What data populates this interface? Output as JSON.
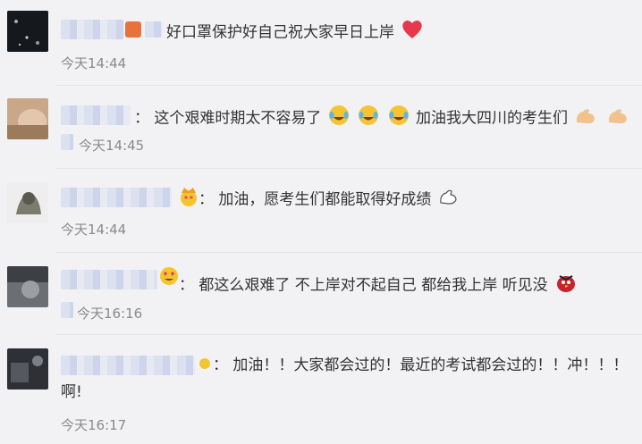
{
  "comments": [
    {
      "text": "好口罩保护好自己祝大家早日上岸",
      "emojis_after": [
        "heart-icon"
      ],
      "time": "今天14:44"
    },
    {
      "text": "这个艰难时期太不容易了",
      "mid_emojis": [
        "laugh-cry-icon",
        "laugh-cry-icon",
        "laugh-cry-icon"
      ],
      "text2": "加油我大四川的考生们",
      "emojis_after": [
        "muscle-icon",
        "muscle-icon"
      ],
      "time": "今天14:45"
    },
    {
      "text": "加油，愿考生们都能取得好成绩",
      "emojis_after": [
        "muscle-icon"
      ],
      "time": "今天14:44"
    },
    {
      "text": "都这么艰难了 不上岸对不起自己 都给我上岸 听见没",
      "emojis_after": [
        "angry-bird-icon"
      ],
      "time": "今天16:16"
    },
    {
      "text": "加油！！大家都会过的！最近的考试都会过的！！冲！！！",
      "text_line2": "啊!",
      "time": "今天16:17"
    }
  ],
  "colors": {
    "background": "#f2f2f5",
    "time": "#8a8a8a",
    "text": "#333333",
    "heart": "#e8384f"
  },
  "separator": "："
}
